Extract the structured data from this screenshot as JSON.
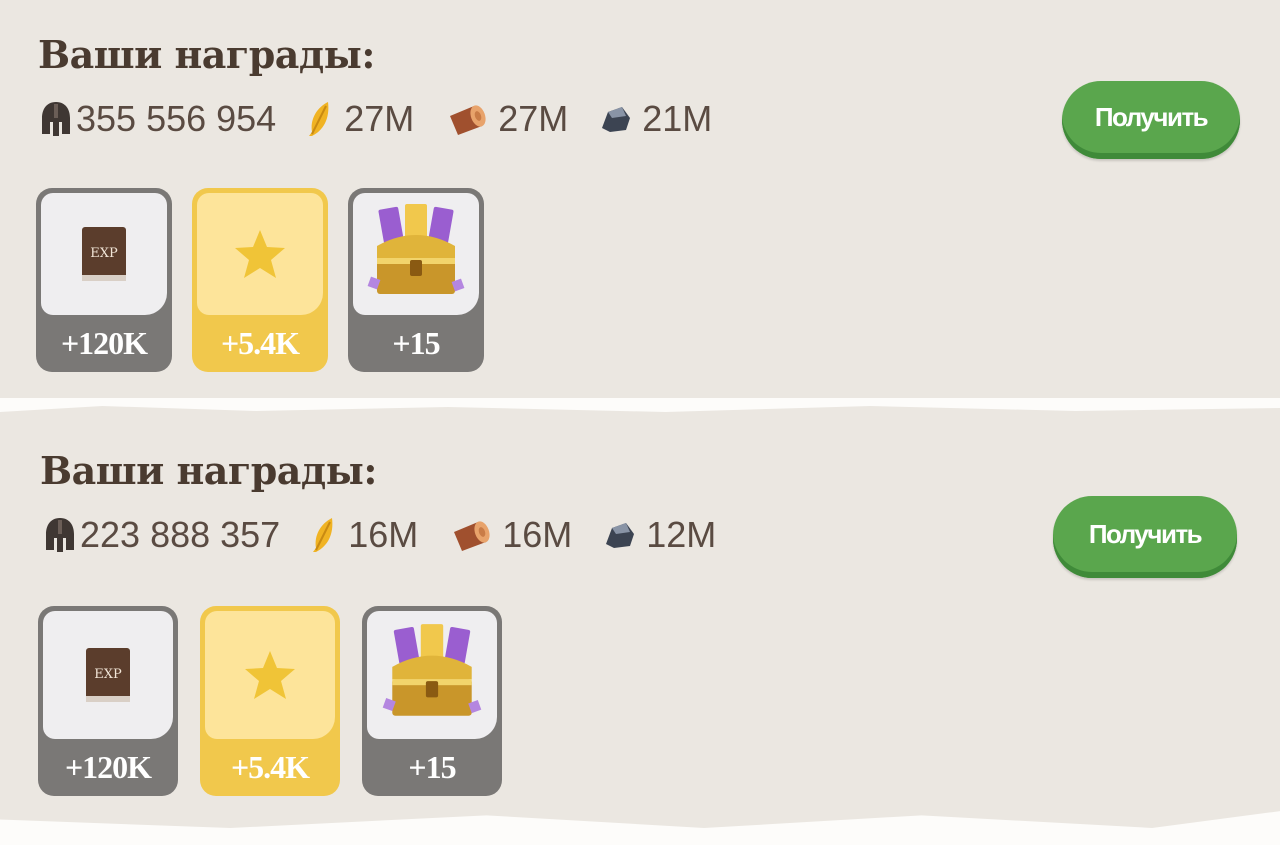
{
  "rewards": [
    {
      "title": "Ваши награды:",
      "resources": [
        {
          "icon": "helmet-icon",
          "value": "355 556 954"
        },
        {
          "icon": "feather-icon",
          "value": "27M"
        },
        {
          "icon": "wood-log-icon",
          "value": "27M"
        },
        {
          "icon": "stone-icon",
          "value": "21M"
        }
      ],
      "button_label": "Получить",
      "items": [
        {
          "icon": "exp-book-icon",
          "icon_text": "EXP",
          "count": "+120K",
          "style": "gray"
        },
        {
          "icon": "star-icon",
          "count": "+5.4K",
          "style": "gold"
        },
        {
          "icon": "treasure-chest-icon",
          "count": "+15",
          "style": "gray"
        }
      ]
    },
    {
      "title": "Ваши награды:",
      "resources": [
        {
          "icon": "helmet-icon",
          "value": "223 888 357"
        },
        {
          "icon": "feather-icon",
          "value": "16M"
        },
        {
          "icon": "wood-log-icon",
          "value": "16M"
        },
        {
          "icon": "stone-icon",
          "value": "12M"
        }
      ],
      "button_label": "Получить",
      "items": [
        {
          "icon": "exp-book-icon",
          "icon_text": "EXP",
          "count": "+120K",
          "style": "gray"
        },
        {
          "icon": "star-icon",
          "count": "+5.4K",
          "style": "gold"
        },
        {
          "icon": "treasure-chest-icon",
          "count": "+15",
          "style": "gray"
        }
      ]
    }
  ],
  "colors": {
    "panel_bg": "#ebe7e1",
    "button_green": "#5aa64d",
    "gold": "#f1c84c",
    "gray": "#7a7876",
    "title_text": "#4a3b30"
  }
}
